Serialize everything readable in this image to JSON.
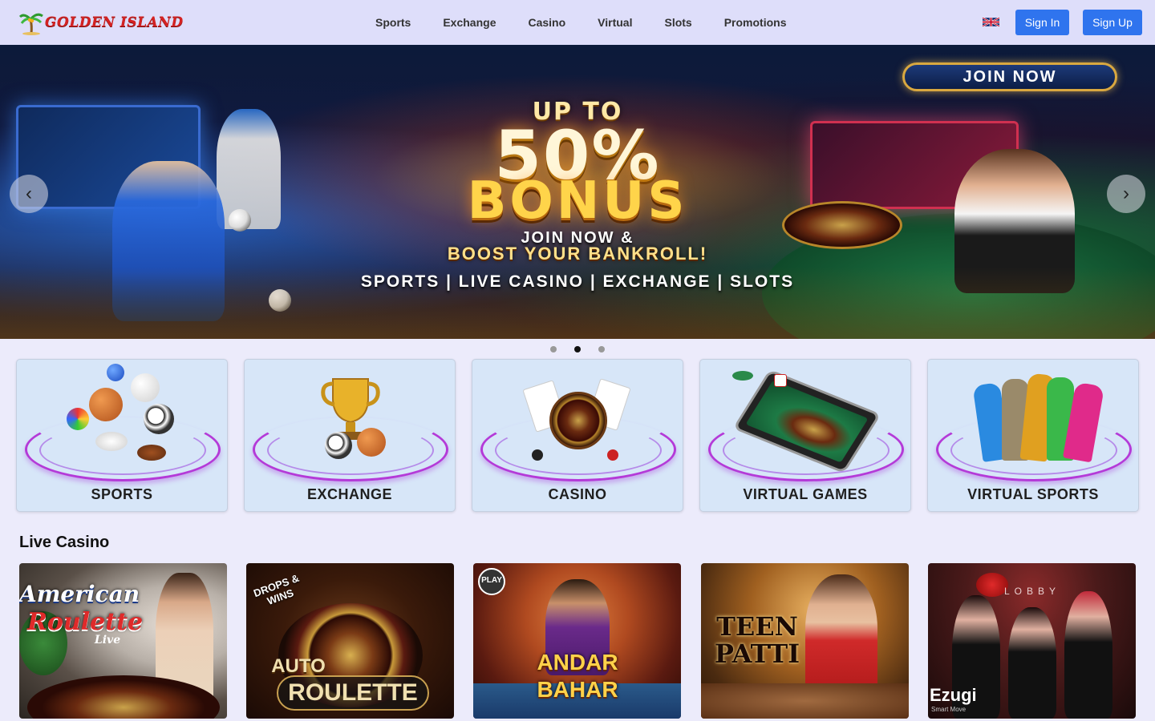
{
  "header": {
    "logo_text": "GOLDEN ISLAND",
    "nav": [
      "Sports",
      "Exchange",
      "Casino",
      "Virtual",
      "Slots",
      "Promotions"
    ],
    "language_icon": "uk-flag-icon",
    "sign_in": "Sign In",
    "sign_up": "Sign Up",
    "accent_color": "#2f74ee"
  },
  "hero": {
    "join_now": "JOIN NOW",
    "up_to": "UP TO",
    "percent": "50%",
    "bonus": "BONUS",
    "join_sub": "JOIN NOW &",
    "boost": "BOOST YOUR BANKROLL!",
    "categories_line": "SPORTS | LIVE CASINO | EXCHANGE | SLOTS",
    "prev_icon": "‹",
    "next_icon": "›",
    "slides": 3,
    "active_slide": 2
  },
  "categories": [
    {
      "label": "SPORTS"
    },
    {
      "label": "EXCHANGE"
    },
    {
      "label": "CASINO"
    },
    {
      "label": "VIRTUAL GAMES"
    },
    {
      "label": "VIRTUAL SPORTS"
    }
  ],
  "live_casino": {
    "title": "Live Casino",
    "games": [
      {
        "line1": "American",
        "line2": "Roulette",
        "line3": "Live"
      },
      {
        "badge": "DROPS & WINS",
        "line1": "AUTO",
        "line2": "ROULETTE"
      },
      {
        "badge": "PLAY",
        "line1": "ANDAR",
        "line2": "BAHAR"
      },
      {
        "line1": "TEEN",
        "line2": "PATTI"
      },
      {
        "badge": "LOBBY",
        "line1": "Ezugi",
        "line2": "Smart Move"
      }
    ]
  }
}
